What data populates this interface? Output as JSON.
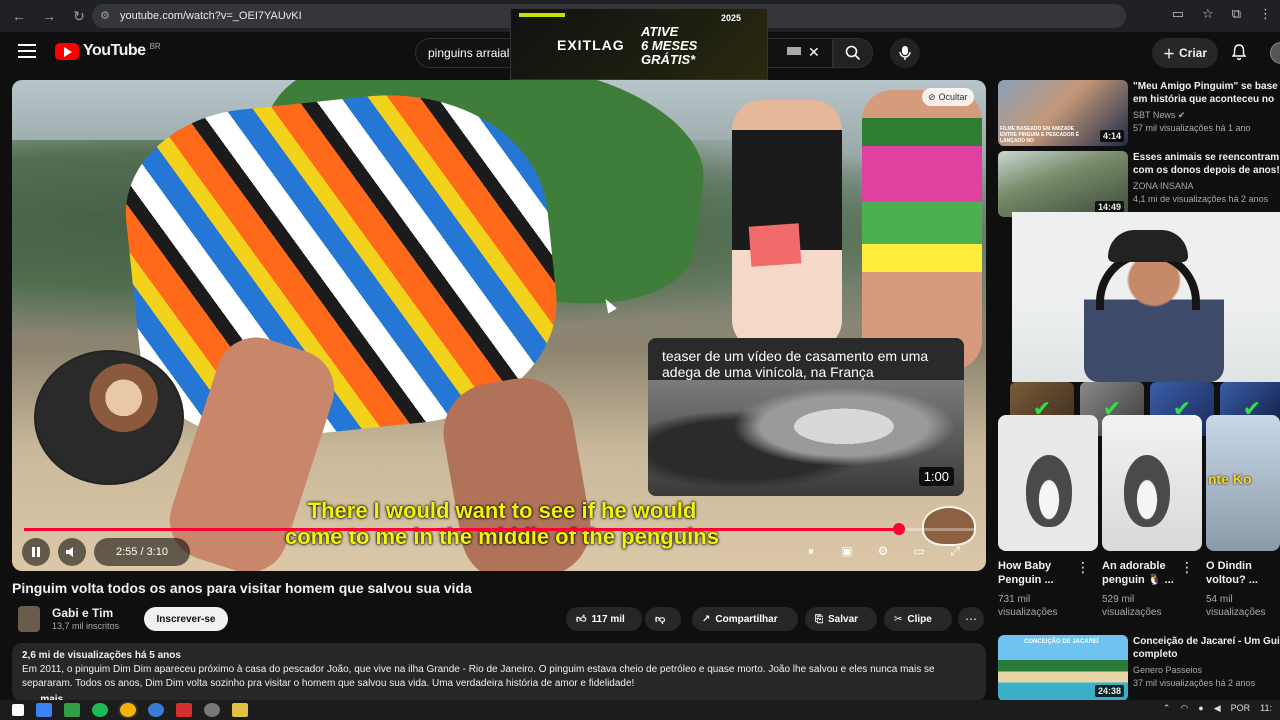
{
  "browser": {
    "url": "youtube.com/watch?v=_OEI7YAUvKI"
  },
  "ad": {
    "brand": "EXITLAG",
    "text_line1": "ATIVE",
    "text_line2": "6 MESES",
    "text_line3": "GRÁTIS*",
    "year": "2025"
  },
  "header": {
    "logo_text": "YouTube",
    "country": "BR",
    "search_value": "pinguins arraial",
    "create_label": "Criar"
  },
  "player": {
    "hide_label": "Ocultar",
    "subtitle_line1": "There I would want to see if he would",
    "subtitle_line2": "come to me in the middle of the penguins",
    "time_display": "2:55 / 3:10",
    "progress_fraction": 0.9211,
    "teaser_text": "teaser de um vídeo de casamento em uma adega de uma vinícola, na França",
    "teaser_duration": "1:00"
  },
  "video": {
    "title": "Pinguim volta todos os anos para visitar homem que salvou sua vida",
    "channel_name": "Gabi e Tim",
    "channel_subs": "13,7 mil inscritos",
    "subscribe_label": "Inscrever-se",
    "likes": "117 mil",
    "share_label": "Compartilhar",
    "save_label": "Salvar",
    "clip_label": "Clipe",
    "desc_meta": "2,6 mi de visualizações  há 5 anos",
    "description": "Em 2011, o pinguim Dim Dim apareceu próximo à casa do pescador João, que vive na ilha Grande - Rio de Janeiro. O pinguim estava cheio de petróleo e quase morto. João lhe salvou e eles nunca mais se separaram. Todos os anos, Dim Dim volta sozinho pra visitar o homem que salvou sua vida. Uma verdadeira história de amor e fidelidade!",
    "more_label": "...mais"
  },
  "recommendations": [
    {
      "title_line1": "\"Meu Amigo Pinguim\" se base",
      "title_line2": "em história que aconteceu no",
      "channel": "SBT News",
      "meta": "57 mil visualizações  há 1 ano",
      "duration": "4:14",
      "thumb_caption": "FILME BASEADO EM AMIZADE ENTRE PINGUIM E PESCADOR É LANÇADO NO"
    },
    {
      "title_line1": "Esses animais se reencontram",
      "title_line2": "com os donos depois de anos!",
      "channel": "ZONA INSANA",
      "meta": "4,1 mi de visualizações  há 2 anos",
      "duration": "14:49"
    },
    {
      "title_line1": "Conceição de Jacareí - Um Gui",
      "title_line2": "completo",
      "channel": "Genero Passeios",
      "meta": "37 mil visualizações  há 2 anos",
      "duration": "24:38",
      "thumb_caption": "CONCEIÇÃO DE JACAREÍ"
    }
  ],
  "shorts": [
    {
      "title_line1": "How Baby",
      "title_line2": "Penguin ...",
      "views_line1": "731 mil",
      "views_line2": "visualizações"
    },
    {
      "title_line1": "An adorable",
      "title_line2": "penguin 🐧 ...",
      "views_line1": "529 mil",
      "views_line2": "visualizações"
    },
    {
      "title_line1": "O Dindin",
      "title_line2": "voltou? ...",
      "views_line1": "54 mil",
      "views_line2": "visualizações",
      "thumb_text": "nte Ko"
    }
  ],
  "taskbar": {
    "lang": "POR",
    "clock": "11:"
  }
}
